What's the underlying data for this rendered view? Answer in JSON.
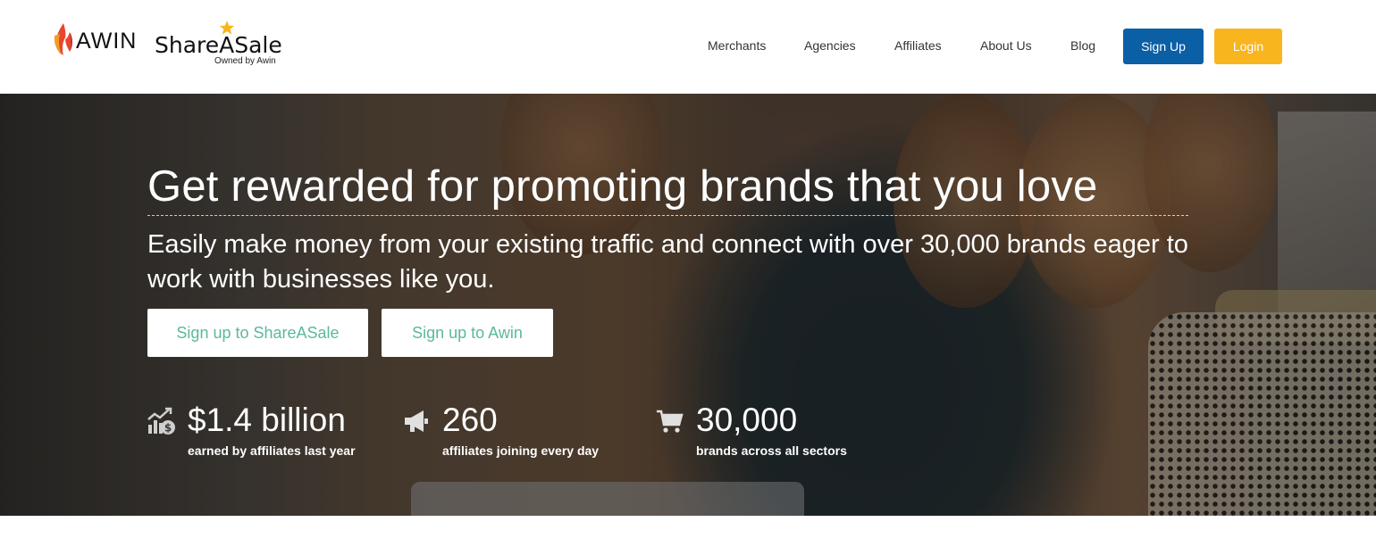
{
  "brand": {
    "awin_logo_text": "AWIN",
    "shareasale_logo_text": "ShareASale",
    "shareasale_owned_by": "Owned by Awin"
  },
  "nav": {
    "items": [
      {
        "label": "Merchants"
      },
      {
        "label": "Agencies"
      },
      {
        "label": "Affiliates"
      },
      {
        "label": "About Us"
      },
      {
        "label": "Blog"
      }
    ],
    "signup_label": "Sign Up",
    "login_label": "Login"
  },
  "hero": {
    "title": "Get rewarded for promoting brands that you love",
    "subtitle": "Easily make money from your existing traffic and connect with over 30,000 brands eager to work with businesses like you.",
    "cta_shareasale": "Sign up to ShareASale",
    "cta_awin": "Sign up to Awin",
    "stats": [
      {
        "icon": "chart-dollar-icon",
        "value": "$1.4 billion",
        "label": "earned by affiliates last year"
      },
      {
        "icon": "megaphone-icon",
        "value": "260",
        "label": "affiliates joining every day"
      },
      {
        "icon": "shopping-cart-icon",
        "value": "30,000",
        "label": "brands across all sectors"
      }
    ]
  },
  "colors": {
    "signup_button": "#0b5fa5",
    "login_button": "#f8b51e",
    "cta_text": "#5bb89e",
    "awin_flame": "#e8472c",
    "star": "#f8b51e"
  }
}
